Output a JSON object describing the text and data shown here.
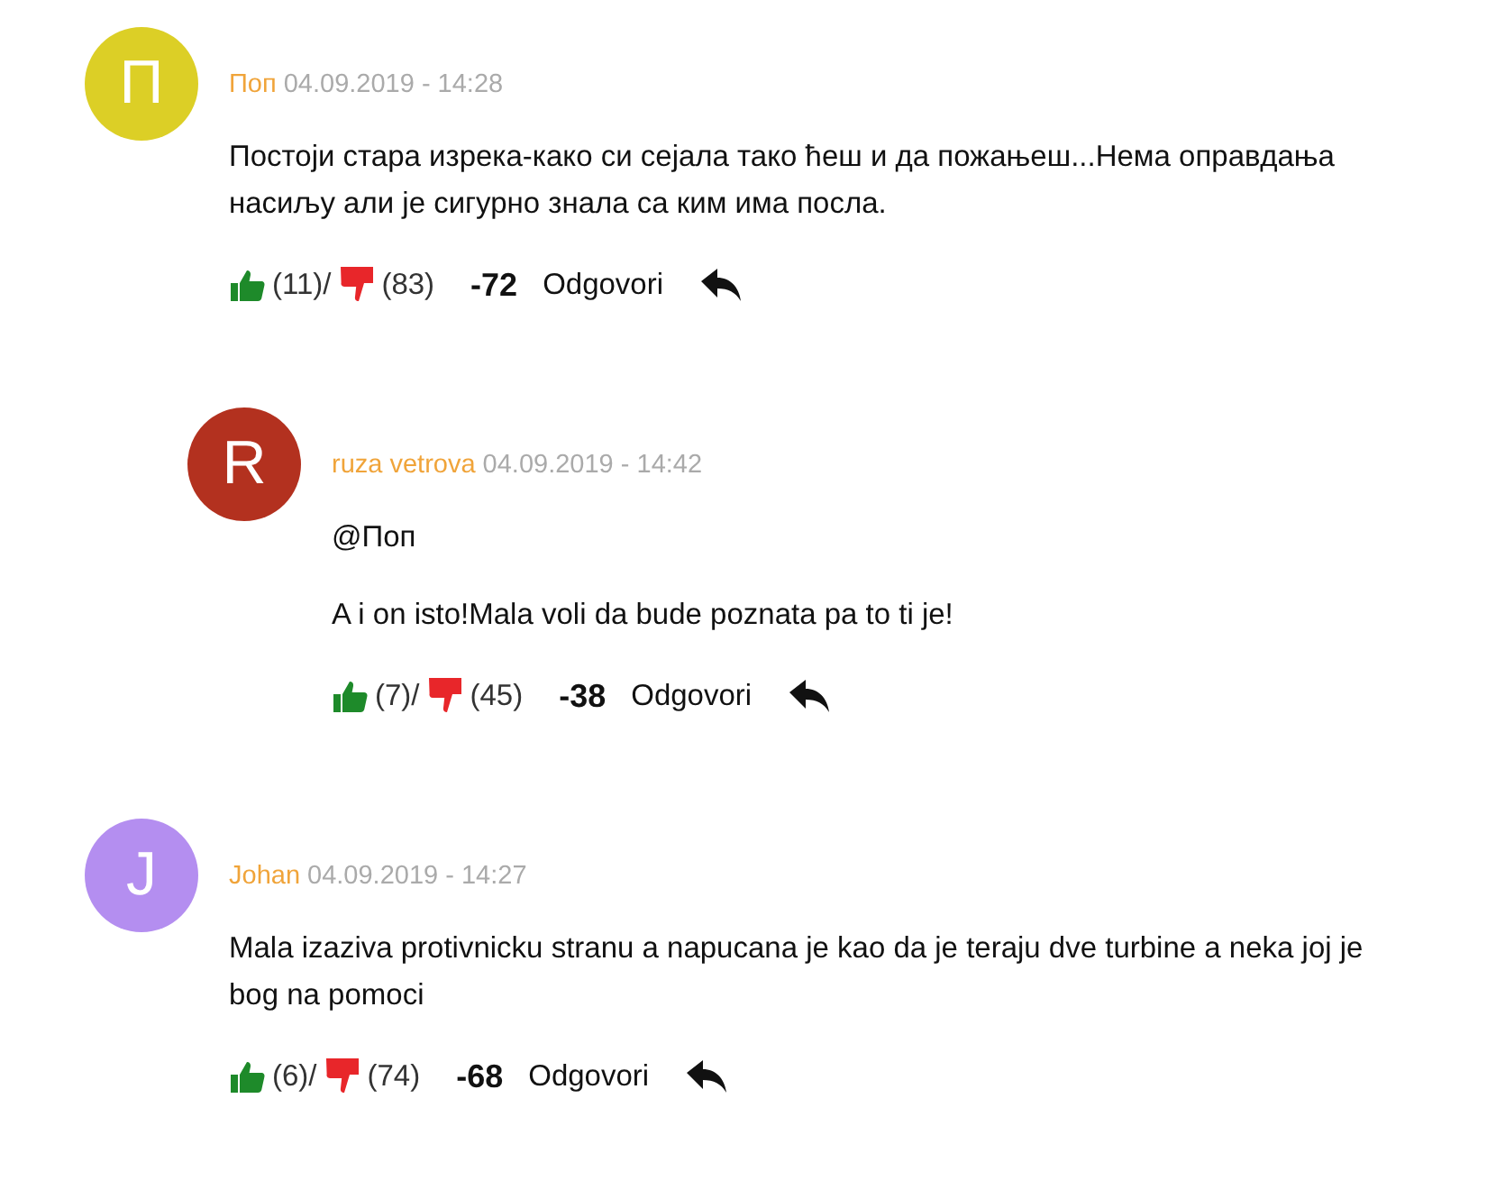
{
  "comments": [
    {
      "initial": "П",
      "color": "#dccf26",
      "author": "Поп",
      "date": "04.09.2019 - 14:28",
      "paragraphs": [
        "Постоји стара изрека-како си сејала тако ћеш и да пожањеш...Нема оправдања насиљу али је сигурно знала са ким има посла."
      ],
      "likes": "(11)/",
      "dislikes": "(83)",
      "score": "-72",
      "reply_label": "Odgovori",
      "children": [
        {
          "initial": "R",
          "color": "#b3311f",
          "author": "ruza vetrova",
          "date": "04.09.2019 - 14:42",
          "paragraphs": [
            "@Поп",
            "A i on isto!Mala voli da bude poznata pa to ti je!"
          ],
          "likes": "(7)/",
          "dislikes": "(45)",
          "score": "-38",
          "reply_label": "Odgovori"
        }
      ]
    },
    {
      "initial": "J",
      "color": "#b48ef0",
      "author": "Johan",
      "date": "04.09.2019 - 14:27",
      "paragraphs": [
        "Mala izaziva protivnicku stranu a napucana je kao da je teraju dve turbine a neka joj je bog na pomoci"
      ],
      "likes": "(6)/",
      "dislikes": "(74)",
      "score": "-68",
      "reply_label": "Odgovori"
    }
  ]
}
